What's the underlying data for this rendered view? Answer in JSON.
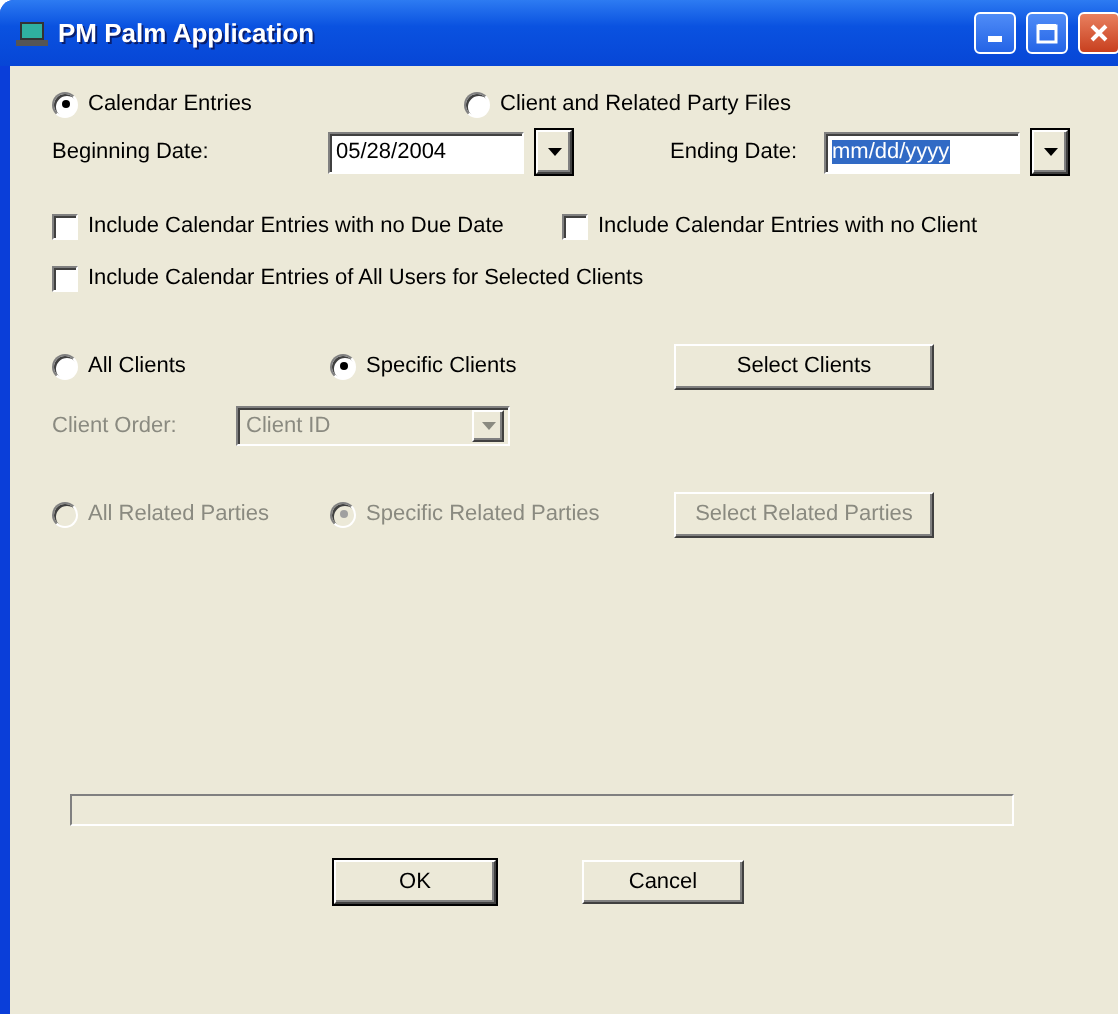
{
  "window": {
    "title": "PM Palm Application"
  },
  "source_options": [
    {
      "label": "Calendar Entries",
      "selected": true
    },
    {
      "label": "Client and Related Party Files",
      "selected": false
    }
  ],
  "beginning_date": {
    "label": "Beginning Date:",
    "value": "05/28/2004",
    "text_selected": false
  },
  "ending_date": {
    "label": "Ending Date:",
    "value": "mm/dd/yyyy",
    "text_selected": true
  },
  "checkboxes": [
    {
      "label": "Include Calendar Entries with no Due Date",
      "checked": false
    },
    {
      "label": "Include Calendar Entries with no Client",
      "checked": false
    },
    {
      "label": "Include Calendar Entries of All Users for Selected Clients",
      "checked": false
    }
  ],
  "client_scope": {
    "options": [
      {
        "label": "All Clients",
        "selected": false
      },
      {
        "label": "Specific Clients",
        "selected": true
      }
    ],
    "button": "Select Clients",
    "disabled": false
  },
  "client_order": {
    "label": "Client Order:",
    "value": "Client ID",
    "disabled": true
  },
  "related_scope": {
    "options": [
      {
        "label": "All Related Parties",
        "selected": false
      },
      {
        "label": "Specific Related Parties",
        "selected": true
      }
    ],
    "button": "Select Related Parties",
    "disabled": true
  },
  "progress": {
    "level": 0
  },
  "buttons": [
    {
      "label": "OK",
      "default": true
    },
    {
      "label": "Cancel",
      "default": false
    }
  ]
}
